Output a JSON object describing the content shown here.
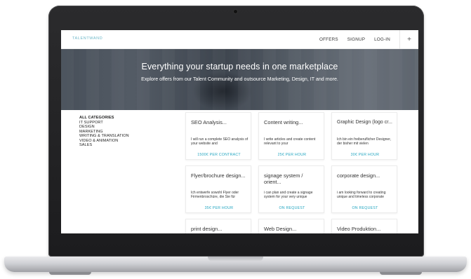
{
  "site": {
    "brand": "TALENTWAND",
    "nav": [
      "OFFERS",
      "SIGNUP",
      "LOG-IN"
    ],
    "nav_plus": "+"
  },
  "hero": {
    "title": "Everything your startup needs in one marketplace",
    "subtitle": "Explore offers from our Talent Community and outsource Marketing, Design, IT and more."
  },
  "categories": [
    "ALL CATEGORIES",
    "IT SUPPORT",
    "DESIGN",
    "MARKETING",
    "WRITING & TRANSLATION",
    "VIDEO & ANIMATION",
    "SALES"
  ],
  "offers": [
    {
      "title": "SEO Analysis...",
      "desc": "I will run a complete SEO analysis of your website and",
      "price": "1500€ PER CONTRACT"
    },
    {
      "title": "Content writing...",
      "desc": "I write articles and create content relevant to your",
      "price": "25€ PER HOUR"
    },
    {
      "title": "Graphic Design (logo cr...",
      "desc": "Ich bin ein freiberuflicher Designer, der bisher mit vielen",
      "price": "30€ PER HOUR"
    },
    {
      "title": "Flyer/brochure design...",
      "desc": "Ich entwerfe sowohl Flyer oder Firmenbroschüre, die Sie für",
      "price": "35€ PER HOUR"
    },
    {
      "title": "signage system / orient...",
      "desc": "i can plan and create a signage system for your very unique",
      "price": "ON REQUEST"
    },
    {
      "title": "corporate design...",
      "desc": "i am looking forward to creating unique and timeless corporate",
      "price": "ON REQUEST"
    },
    {
      "title": "print design...",
      "desc": "",
      "price": ""
    },
    {
      "title": "Web Design...",
      "desc": "",
      "price": ""
    },
    {
      "title": "Video Produktion...",
      "desc": "",
      "price": ""
    }
  ],
  "colors": {
    "accent": "#27a7c2",
    "brand": "#6cb7c8",
    "laptop_bezel": "#1c1c1e",
    "laptop_body": "#cfd0d4"
  }
}
